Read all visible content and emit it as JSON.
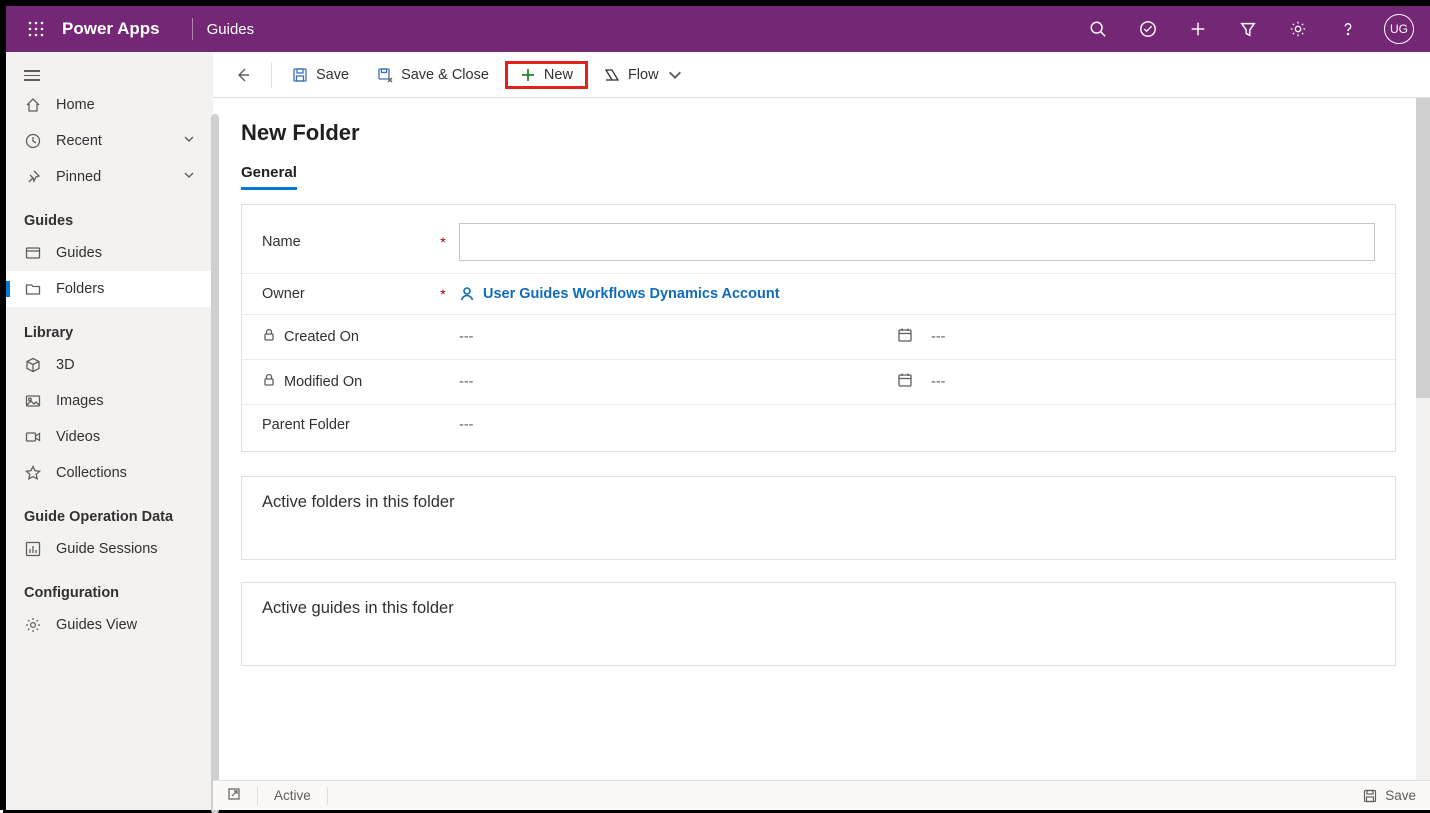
{
  "header": {
    "app_name": "Power Apps",
    "breadcrumb": "Guides",
    "avatar_initials": "UG"
  },
  "sidebar": {
    "nav": {
      "home": "Home",
      "recent": "Recent",
      "pinned": "Pinned"
    },
    "sections": [
      {
        "heading": "Guides",
        "items": [
          {
            "label": "Guides",
            "key": "guides"
          },
          {
            "label": "Folders",
            "key": "folders",
            "selected": true
          }
        ]
      },
      {
        "heading": "Library",
        "items": [
          {
            "label": "3D"
          },
          {
            "label": "Images"
          },
          {
            "label": "Videos"
          },
          {
            "label": "Collections"
          }
        ]
      },
      {
        "heading": "Guide Operation Data",
        "items": [
          {
            "label": "Guide Sessions"
          }
        ]
      },
      {
        "heading": "Configuration",
        "items": [
          {
            "label": "Guides View"
          }
        ]
      }
    ]
  },
  "commandbar": {
    "save": "Save",
    "save_close": "Save & Close",
    "new": "New",
    "flow": "Flow"
  },
  "page": {
    "title": "New Folder",
    "tab": "General",
    "fields": {
      "name_label": "Name",
      "owner_label": "Owner",
      "owner_value": "User Guides Workflows Dynamics Account",
      "created_label": "Created On",
      "created_value": "---",
      "created_time": "---",
      "modified_label": "Modified On",
      "modified_value": "---",
      "modified_time": "---",
      "parent_label": "Parent Folder",
      "parent_value": "---"
    },
    "subsections": {
      "active_folders": "Active folders in this folder",
      "active_guides": "Active guides in this folder"
    }
  },
  "statusbar": {
    "status": "Active",
    "save": "Save"
  }
}
